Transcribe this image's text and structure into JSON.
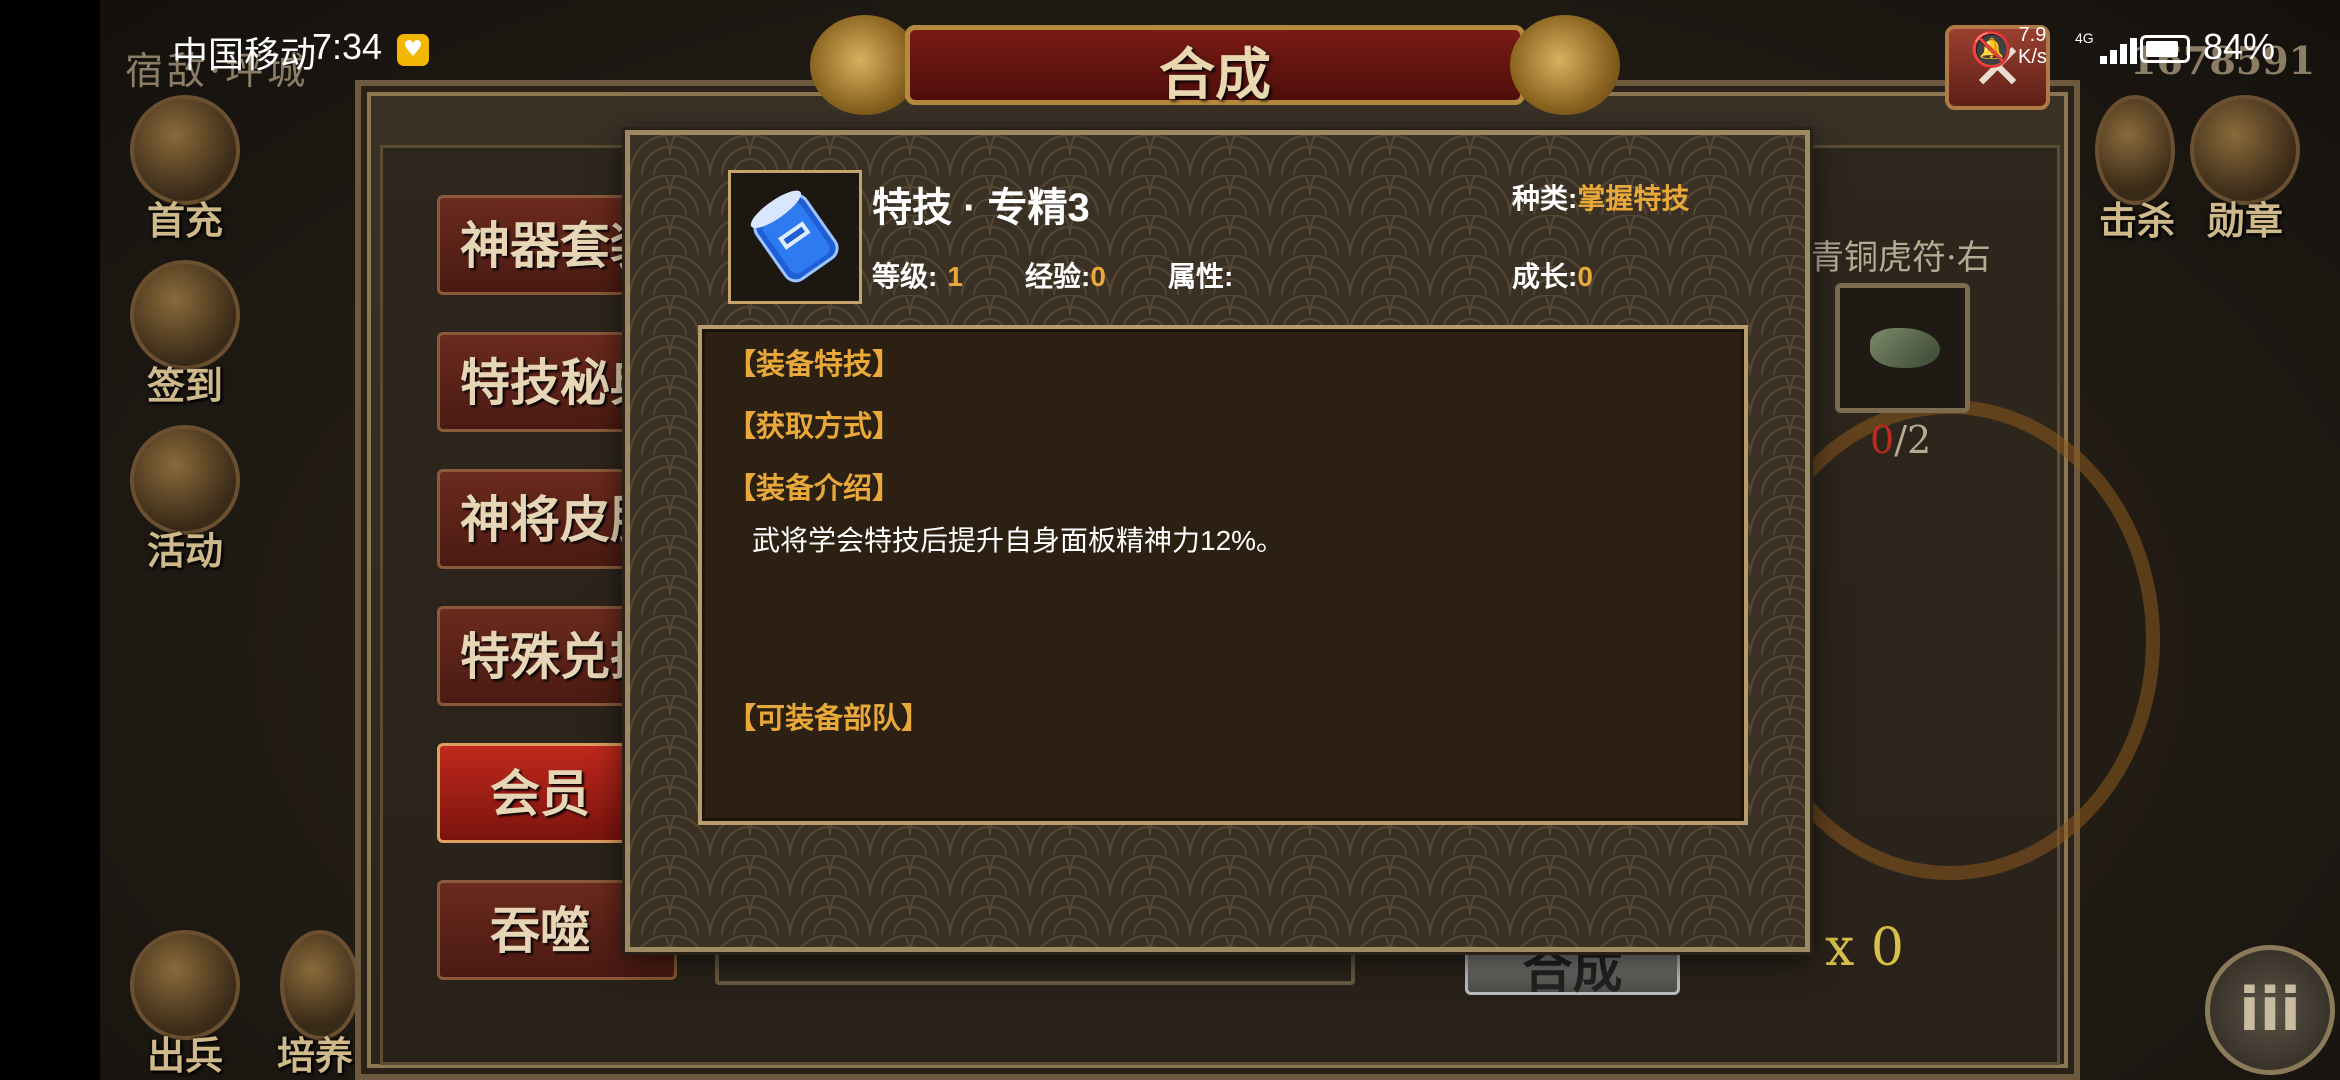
{
  "statusbar": {
    "carrier": "中国移动",
    "time": "7:34",
    "speed_value": "7.9",
    "speed_unit": "K/s",
    "network": "4G",
    "battery": "84%",
    "battery_level": 0.84
  },
  "background": {
    "top_left_text": "宿敌·坪城",
    "top_right_value": "1678591",
    "side_icons_left": [
      "首充",
      "签到",
      "活动"
    ],
    "bottom_icons": [
      "出兵",
      "培养"
    ],
    "side_icons_right": [
      "击杀",
      "勋章"
    ]
  },
  "panel": {
    "title": "合成",
    "close_label": "✕",
    "menu": [
      {
        "label": "神器套装"
      },
      {
        "label": "特技秘典"
      },
      {
        "label": "神将皮肤"
      },
      {
        "label": "特殊兑换"
      },
      {
        "label": "会员"
      },
      {
        "label": "吞噬"
      }
    ],
    "active_menu_index": 4,
    "target_item_name": "青铜虎符·右",
    "target_item_owned": "0",
    "target_item_required": "/2",
    "synth_button": "合成",
    "coin_count": "x 0",
    "menu_icon": "iii"
  },
  "popup": {
    "skill_name": "特技 · 专精3",
    "category_label": "种类:",
    "category_value": "掌握特技",
    "level_label": "等级:",
    "level_value": "1",
    "exp_label": "经验:",
    "exp_value": "0",
    "attr_label": "属性:",
    "attr_value": "",
    "growth_label": "成长:",
    "growth_value": "0",
    "sections": {
      "equip_skill": "【装备特技】",
      "obtain": "【获取方式】",
      "intro": "【装备介绍】",
      "intro_text": "武将学会特技后提升自身面板精神力12%。",
      "equippable_units": "【可装备部队】"
    }
  },
  "colors": {
    "accent_gold": "#e8a93a",
    "active_tab_red": "#c0281c",
    "count_red": "#c02a1c"
  }
}
